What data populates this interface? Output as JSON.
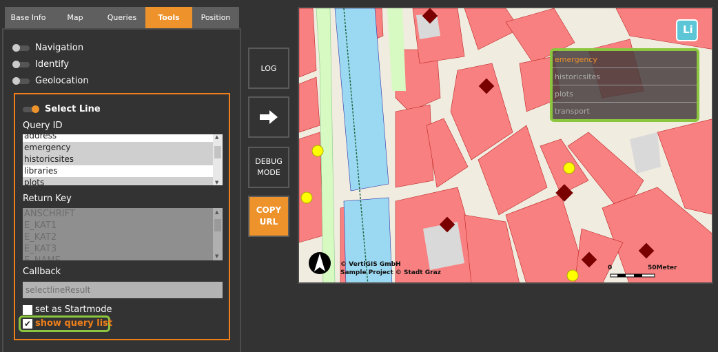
{
  "tabs": [
    {
      "label": "Base Info"
    },
    {
      "label": "Map"
    },
    {
      "label": "Queries"
    },
    {
      "label": "Tools",
      "active": true
    },
    {
      "label": "Position"
    }
  ],
  "tools": [
    {
      "label": "Navigation",
      "on": false
    },
    {
      "label": "Identify",
      "on": false
    },
    {
      "label": "Geolocation",
      "on": false
    }
  ],
  "select_line": {
    "title": "Select Line",
    "on": true,
    "query_id_label": "Query ID",
    "query_ids": [
      {
        "label": "address",
        "selected": false
      },
      {
        "label": "emergency",
        "selected": true
      },
      {
        "label": "historicsites",
        "selected": true
      },
      {
        "label": "libraries",
        "selected": false
      },
      {
        "label": "plots",
        "selected": true
      }
    ],
    "return_key_label": "Return Key",
    "return_keys": [
      "ANSCHRIFT",
      "E_KAT1",
      "E_KAT2",
      "E_KAT3",
      "E_NAME"
    ],
    "callback_label": "Callback",
    "callback_value": "selectlineResult",
    "startmode_label": "set as Startmode",
    "startmode_checked": false,
    "show_query_list_label": "show query list",
    "show_query_list_checked": true
  },
  "buttons": {
    "log": "LOG",
    "arrow": "arrow-right-icon",
    "debug": "DEBUG MODE",
    "copy_url": "COPY URL"
  },
  "map": {
    "query_list": [
      {
        "label": "emergency",
        "active": true
      },
      {
        "label": "historicsites"
      },
      {
        "label": "plots"
      },
      {
        "label": "transport"
      }
    ],
    "logo_text": "Li",
    "copyright_1": "© VertiGIS GmbH",
    "copyright_2": "Sample Project © Stadt Graz",
    "scale_start": "0",
    "scale_end": "50Meter",
    "colors": {
      "building": "#f98080",
      "water": "#9ad9f1",
      "green": "#d7f9c2",
      "road": "#f0ece0",
      "highlight": "#8cc63f",
      "accent": "#ee922b"
    }
  }
}
